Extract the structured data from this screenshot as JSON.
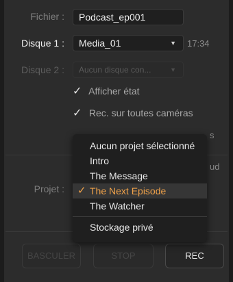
{
  "fields": {
    "fichier_label": "Fichier :",
    "fichier_value": "Podcast_ep001",
    "disque1_label": "Disque 1 :",
    "disque1_value": "Media_01",
    "disque1_time": "17:34",
    "disque2_label": "Disque 2 :",
    "disque2_placeholder": "Aucun disque con..."
  },
  "checkboxes": [
    {
      "label": "Afficher état",
      "checked": true
    },
    {
      "label": "Rec. sur toutes caméras",
      "checked": true
    }
  ],
  "partial_text": {
    "right_s": "s",
    "right_ud": "ud"
  },
  "project": {
    "label": "Projet :",
    "options": [
      "Aucun projet sélectionné",
      "Intro",
      "The Message",
      "The Next Episode",
      "The Watcher",
      "Stockage privé"
    ],
    "selected": "The Next Episode"
  },
  "buttons": {
    "basculer": "BASCULER",
    "stop": "STOP",
    "rec": "REC"
  },
  "colors": {
    "accent_selected": "#f0a24a",
    "panel_bg": "#2c2c2c"
  }
}
